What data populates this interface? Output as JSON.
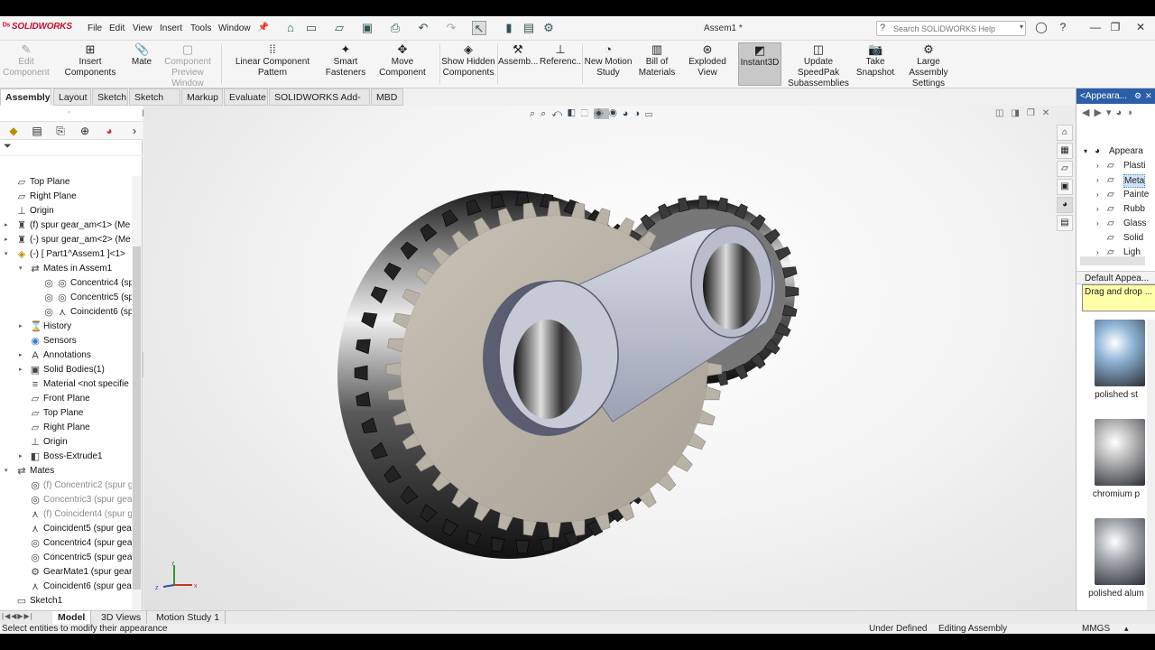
{
  "app": {
    "brand": "SOLIDWORKS",
    "title": "Assem1 *"
  },
  "menu": [
    "File",
    "Edit",
    "View",
    "Insert",
    "Tools",
    "Window"
  ],
  "search": {
    "placeholder": "Search SOLIDWORKS Help"
  },
  "ribbon": [
    {
      "label": "Edit Component",
      "disabled": true,
      "icon": "edit-component-icon"
    },
    {
      "label": "Insert Components",
      "icon": "insert-components-icon"
    },
    {
      "label": "Mate",
      "icon": "mate-icon"
    },
    {
      "label": "Component Preview Window",
      "disabled": true,
      "icon": "preview-window-icon"
    },
    {
      "label": "Linear Component Pattern",
      "icon": "pattern-icon"
    },
    {
      "label": "Smart Fasteners",
      "icon": "fastener-icon"
    },
    {
      "label": "Move Component",
      "icon": "move-component-icon"
    },
    {
      "label": "Show Hidden Components",
      "icon": "show-hidden-icon"
    },
    {
      "label": "Assemb...",
      "icon": "assembly-icon"
    },
    {
      "label": "Referenc...",
      "icon": "reference-icon"
    },
    {
      "label": "New Motion Study",
      "icon": "motion-study-icon"
    },
    {
      "label": "Bill of Materials",
      "icon": "bom-icon"
    },
    {
      "label": "Exploded View",
      "icon": "exploded-view-icon"
    },
    {
      "label": "Instant3D",
      "active": true,
      "icon": "instant3d-icon"
    },
    {
      "label": "Update SpeedPak Subassemblies",
      "icon": "speedpak-icon"
    },
    {
      "label": "Take Snapshot",
      "icon": "snapshot-icon"
    },
    {
      "label": "Large Assembly Settings",
      "icon": "large-assembly-icon"
    }
  ],
  "tabs": [
    "Assembly",
    "Layout",
    "Sketch",
    "Sketch Ink",
    "Markup",
    "Evaluate",
    "SOLIDWORKS Add-Ins",
    "MBD"
  ],
  "tree": [
    {
      "label": "Top Plane"
    },
    {
      "label": "Right Plane"
    },
    {
      "label": "Origin"
    },
    {
      "label": "(f) spur gear_am<1> (Me"
    },
    {
      "label": "(-) spur gear_am<2> (Me"
    },
    {
      "label": "(-) [ Part1^Assem1 ]<1>"
    },
    {
      "label": "Mates in Assem1"
    },
    {
      "label": "Concentric4 (sp"
    },
    {
      "label": "Concentric5 (sp"
    },
    {
      "label": "Coincident6 (sp"
    },
    {
      "label": "History"
    },
    {
      "label": "Sensors"
    },
    {
      "label": "Annotations"
    },
    {
      "label": "Solid Bodies(1)"
    },
    {
      "label": "Material <not specifie"
    },
    {
      "label": "Front Plane"
    },
    {
      "label": "Top Plane"
    },
    {
      "label": "Right Plane"
    },
    {
      "label": "Origin"
    },
    {
      "label": "Boss-Extrude1"
    },
    {
      "label": "Mates"
    },
    {
      "label": "(f) Concentric2 (spur g"
    },
    {
      "label": "Concentric3 (spur gea"
    },
    {
      "label": "(f) Coincident4 (spur g"
    },
    {
      "label": "Coincident5 (spur gea"
    },
    {
      "label": "Concentric4 (spur gea"
    },
    {
      "label": "Concentric5 (spur gea"
    },
    {
      "label": "GearMate1 (spur gear"
    },
    {
      "label": "Coincident6 (spur gea"
    },
    {
      "label": "Sketch1"
    }
  ],
  "right_panel": {
    "header": "<Appeara...",
    "tree": [
      "Appeara",
      "Plasti",
      "Meta",
      "Painte",
      "Rubb",
      "Glass",
      "Solid",
      "Ligh"
    ],
    "default_label": "Default Appea...",
    "tooltip": "Drag and drop ...",
    "swatches": [
      {
        "label": "polished st",
        "color": "#8fb4d6"
      },
      {
        "label": "chromium p",
        "color": "#b8b8b8"
      },
      {
        "label": "polished alum",
        "color": "#a9acb1"
      }
    ]
  },
  "triad": {
    "x": "x",
    "y": "y",
    "z": "z"
  },
  "bottom_tabs": [
    "Model",
    "3D Views",
    "Motion Study 1"
  ],
  "status": {
    "message": "Select entities to modify their appearance",
    "definition": "Under Defined",
    "mode": "Editing Assembly",
    "units": "MMGS"
  }
}
